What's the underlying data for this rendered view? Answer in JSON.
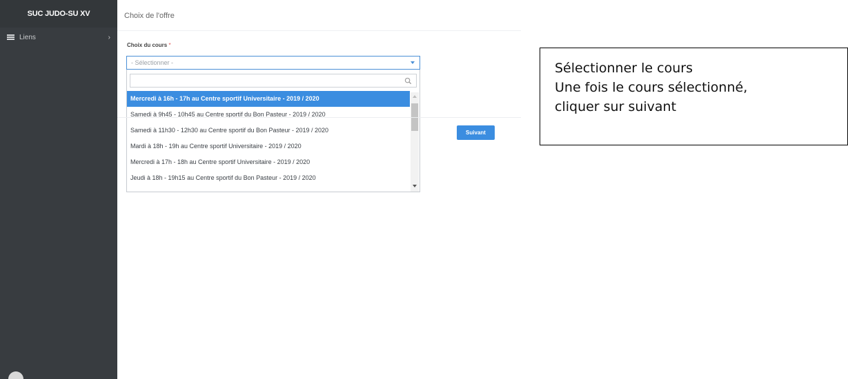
{
  "sidebar": {
    "brand": "SUC JUDO-SU XV",
    "items": [
      {
        "label": "Liens",
        "icon": "menu-icon",
        "expand_icon": "chevron-right-icon"
      }
    ]
  },
  "header": {
    "title": "Choix de l'offre"
  },
  "form": {
    "course_label": "Choix du cours",
    "required_mark": "*",
    "select_placeholder": "- Sélectionner -",
    "search_value": "",
    "options": [
      "Mercredi à 16h - 17h au Centre sportif Universitaire - 2019 / 2020",
      "Samedi à 9h45 - 10h45 au Centre sportif du Bon Pasteur - 2019 / 2020",
      "Samedi à 11h30 - 12h30 au Centre sportif du Bon Pasteur - 2019 / 2020",
      "Mardi à 18h - 19h au Centre sportif Universitaire - 2019 / 2020",
      "Mercredi à 17h - 18h au Centre sportif Universitaire - 2019 / 2020",
      "Jeudi à 18h - 19h15 au Centre sportif du Bon Pasteur - 2019 / 2020"
    ],
    "selected_index": 0,
    "next_label": "Suivant"
  },
  "annotation": {
    "lines": [
      "Sélectionner le cours",
      "Une fois le cours sélectionné,",
      "cliquer sur suivant"
    ]
  },
  "colors": {
    "sidebar_bg": "#383c40",
    "accent": "#3b8de0",
    "required": "#e05656"
  }
}
